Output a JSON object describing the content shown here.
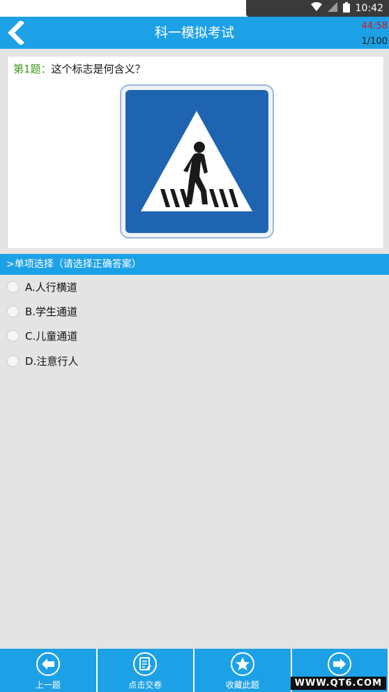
{
  "status_bar": {
    "time": "10:42"
  },
  "header": {
    "title": "科一模拟考试",
    "timer": "44:58",
    "progress": "1/100"
  },
  "question": {
    "number_label": "第1题：",
    "text": "这个标志是何含义？",
    "image_icon": "pedestrian-crossing-sign"
  },
  "section": {
    "label": ">单项选择（请选择正确答案）"
  },
  "options": [
    {
      "label": "A.人行横道"
    },
    {
      "label": "B.学生通道"
    },
    {
      "label": "C.儿童通道"
    },
    {
      "label": "D.注意行人"
    }
  ],
  "bottom_nav": [
    {
      "label": "上一题",
      "icon": "arrow-left-icon"
    },
    {
      "label": "点击交卷",
      "icon": "submit-paper-icon"
    },
    {
      "label": "收藏此题",
      "icon": "star-icon"
    },
    {
      "label": "",
      "icon": "arrow-right-icon"
    }
  ],
  "watermark": "WWW.QT6.COM",
  "colors": {
    "primary": "#1da1e6",
    "timer": "#d6141c",
    "question_number": "#3a9a1a",
    "sign_blue": "#1f64b0"
  }
}
